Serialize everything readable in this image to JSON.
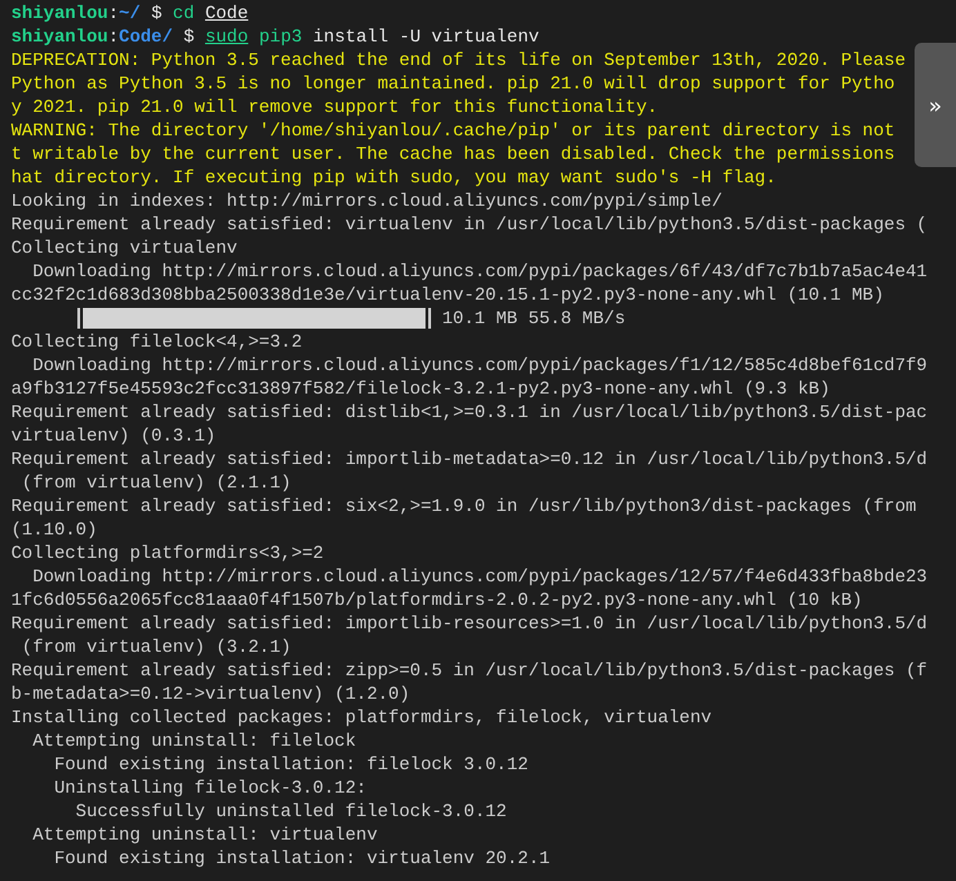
{
  "lines": [
    {
      "kind": "prompt",
      "user": "shiyanlou",
      "separator": ":",
      "path": "~/",
      "symbol": "$",
      "tokens": [
        {
          "text": "cd",
          "kind": "command",
          "underlined": false
        },
        {
          "text": "Code",
          "kind": "argument",
          "underlined": true
        }
      ]
    },
    {
      "kind": "prompt",
      "user": "shiyanlou",
      "separator": ":",
      "path": "Code/",
      "symbol": "$",
      "tokens": [
        {
          "text": "sudo",
          "kind": "command",
          "underlined": true
        },
        {
          "text": "pip3",
          "kind": "command",
          "underlined": false
        },
        {
          "text": "install -U virtualenv",
          "kind": "argument",
          "underlined": false
        }
      ]
    },
    {
      "kind": "warning",
      "text": "DEPRECATION: Python 3.5 reached the end of its life on September 13th, 2020. Please"
    },
    {
      "kind": "warning",
      "text": "Python as Python 3.5 is no longer maintained. pip 21.0 will drop support for Pytho"
    },
    {
      "kind": "warning",
      "text": "y 2021. pip 21.0 will remove support for this functionality."
    },
    {
      "kind": "warning",
      "text": "WARNING: The directory '/home/shiyanlou/.cache/pip' or its parent directory is not"
    },
    {
      "kind": "warning",
      "text": "t writable by the current user. The cache has been disabled. Check the permissions"
    },
    {
      "kind": "warning",
      "text": "hat directory. If executing pip with sudo, you may want sudo's -H flag."
    },
    {
      "kind": "output",
      "text": "Looking in indexes: http://mirrors.cloud.aliyuncs.com/pypi/simple/"
    },
    {
      "kind": "output",
      "text": "Requirement already satisfied: virtualenv in /usr/local/lib/python3.5/dist-packages ("
    },
    {
      "kind": "output",
      "text": "Collecting virtualenv"
    },
    {
      "kind": "output",
      "text": "  Downloading http://mirrors.cloud.aliyuncs.com/pypi/packages/6f/43/df7c7b1b7a5ac4e41"
    },
    {
      "kind": "output",
      "text": "cc32f2c1d683d308bba2500338d1e3e/virtualenv-20.15.1-py2.py3-none-any.whl (10.1 MB)"
    },
    {
      "kind": "progress",
      "level": 1,
      "reading": "10.1 MB 55.8 MB/s"
    },
    {
      "kind": "output",
      "text": "Collecting filelock<4,>=3.2"
    },
    {
      "kind": "output",
      "text": "  Downloading http://mirrors.cloud.aliyuncs.com/pypi/packages/f1/12/585c4d8bef61cd7f9"
    },
    {
      "kind": "output",
      "text": "a9fb3127f5e45593c2fcc313897f582/filelock-3.2.1-py2.py3-none-any.whl (9.3 kB)"
    },
    {
      "kind": "output",
      "text": "Requirement already satisfied: distlib<1,>=0.3.1 in /usr/local/lib/python3.5/dist-pac"
    },
    {
      "kind": "output",
      "text": "virtualenv) (0.3.1)"
    },
    {
      "kind": "output",
      "text": "Requirement already satisfied: importlib-metadata>=0.12 in /usr/local/lib/python3.5/d"
    },
    {
      "kind": "output",
      "text": " (from virtualenv) (2.1.1)"
    },
    {
      "kind": "output",
      "text": "Requirement already satisfied: six<2,>=1.9.0 in /usr/lib/python3/dist-packages (from"
    },
    {
      "kind": "output",
      "text": "(1.10.0)"
    },
    {
      "kind": "output",
      "text": "Collecting platformdirs<3,>=2"
    },
    {
      "kind": "output",
      "text": "  Downloading http://mirrors.cloud.aliyuncs.com/pypi/packages/12/57/f4e6d433fba8bde23"
    },
    {
      "kind": "output",
      "text": "1fc6d0556a2065fcc81aaa0f4f1507b/platformdirs-2.0.2-py2.py3-none-any.whl (10 kB)"
    },
    {
      "kind": "output",
      "text": "Requirement already satisfied: importlib-resources>=1.0 in /usr/local/lib/python3.5/d"
    },
    {
      "kind": "output",
      "text": " (from virtualenv) (3.2.1)"
    },
    {
      "kind": "output",
      "text": "Requirement already satisfied: zipp>=0.5 in /usr/local/lib/python3.5/dist-packages (f"
    },
    {
      "kind": "output",
      "text": "b-metadata>=0.12->virtualenv) (1.2.0)"
    },
    {
      "kind": "output",
      "text": "Installing collected packages: platformdirs, filelock, virtualenv"
    },
    {
      "kind": "output",
      "text": "  Attempting uninstall: filelock"
    },
    {
      "kind": "output",
      "text": "    Found existing installation: filelock 3.0.12"
    },
    {
      "kind": "output",
      "text": "    Uninstalling filelock-3.0.12:"
    },
    {
      "kind": "output",
      "text": "      Successfully uninstalled filelock-3.0.12"
    },
    {
      "kind": "output",
      "text": "  Attempting uninstall: virtualenv"
    },
    {
      "kind": "output",
      "text": "    Found existing installation: virtualenv 20.2.1"
    }
  ],
  "side_panel_toggle": {
    "label": "»"
  }
}
